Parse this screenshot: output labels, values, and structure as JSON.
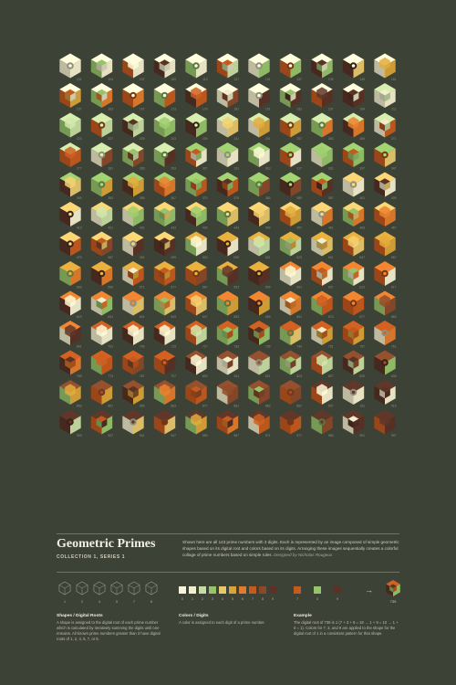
{
  "title": "Geometric Primes",
  "subtitle": "COLLECTION 1, SERIES 1",
  "description": "Shown here are all 143 prime numbers with 3 digits. Each is represented by an image composed of simple geometric shapes based on its digital root and colors based on its digits. Arranging these images sequentially creates a colorful collage of prime numbers based on simple rules.",
  "credit": "Designed by Nicholas Rougeux",
  "palette": [
    "#f2eecd",
    "#c7dca2",
    "#97c46a",
    "#e8c76c",
    "#d9a43a",
    "#e07c2d",
    "#c55a1f",
    "#8a4a2a",
    "#5a3326"
  ],
  "primes": [
    101,
    103,
    107,
    109,
    113,
    127,
    131,
    137,
    139,
    149,
    151,
    157,
    163,
    167,
    173,
    179,
    181,
    191,
    193,
    197,
    199,
    211,
    223,
    227,
    229,
    233,
    239,
    241,
    251,
    257,
    263,
    269,
    271,
    277,
    281,
    283,
    293,
    307,
    311,
    313,
    317,
    331,
    337,
    347,
    349,
    353,
    359,
    367,
    373,
    379,
    383,
    389,
    397,
    401,
    409,
    419,
    421,
    431,
    433,
    439,
    443,
    449,
    457,
    461,
    463,
    467,
    479,
    487,
    491,
    499,
    503,
    509,
    521,
    523,
    541,
    547,
    557,
    563,
    569,
    571,
    577,
    587,
    593,
    599,
    601,
    607,
    613,
    617,
    619,
    631,
    641,
    643,
    647,
    653,
    659,
    661,
    673,
    677,
    683,
    691,
    701,
    709,
    719,
    727,
    733,
    739,
    743,
    751,
    757,
    761,
    769,
    773,
    787,
    797,
    809,
    811,
    821,
    823,
    827,
    829,
    839,
    853,
    857,
    859,
    863,
    877,
    881,
    883,
    887,
    907,
    911,
    919,
    929,
    937,
    941,
    947,
    953,
    967,
    971,
    977,
    983,
    991,
    997
  ],
  "shapes_section": {
    "heading": "Shapes / Digital Roots",
    "text": "A shape is assigned to the digital root of each prime number which is calculated by iteratively summing the digits until one remains. All known prime numbers greater than 3 have digital roots of 1, 2, 4, 5, 7, or 8.",
    "roots": [
      "1",
      "2",
      "4",
      "5",
      "7",
      "8"
    ]
  },
  "colors_section": {
    "heading": "Colors / Digits",
    "text": "A color is assigned to each digit of a prime number.",
    "digits": [
      "0",
      "1",
      "2",
      "3",
      "4",
      "5",
      "6",
      "7",
      "8",
      "9"
    ]
  },
  "example_section": {
    "heading": "Example",
    "text": "The digital root of 739 is 1 (7 + 3 + 9 = 19 → 1 + 9 = 10 → 1 + 0 = 1). Colors for 7, 3, and 9 are applied to the shape for the digital root of 1 in a consistent pattern for that shape.",
    "digits": [
      "7",
      "3",
      "9"
    ],
    "arrow": "→",
    "number": "739"
  }
}
